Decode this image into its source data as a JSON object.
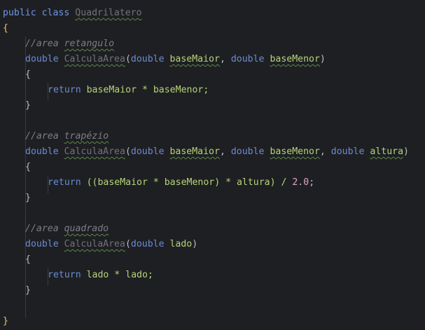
{
  "code": {
    "kw_public": "public",
    "kw_class": "class",
    "class_name": "Quadrilatero",
    "open_brace": "{",
    "close_brace": "}",
    "comment_prefix": "//",
    "comment1_a": "area",
    "comment1_b": "retangulo",
    "comment2_a": "area",
    "comment2_b": "trapézio",
    "comment3_a": "area",
    "comment3_b": "quadrado",
    "kw_double": "double",
    "kw_return": "return",
    "method_name": "CalculaArea",
    "param_baseMaior": "baseMaior",
    "param_baseMenor": "baseMenor",
    "param_altura": "altura",
    "param_lado": "lado",
    "body1": "baseMaior * baseMenor;",
    "body2_a": "((baseMaior * baseMenor) * altura) / ",
    "body2_num": "2.0",
    "body2_end": ";",
    "body3": "lado * lado;"
  }
}
